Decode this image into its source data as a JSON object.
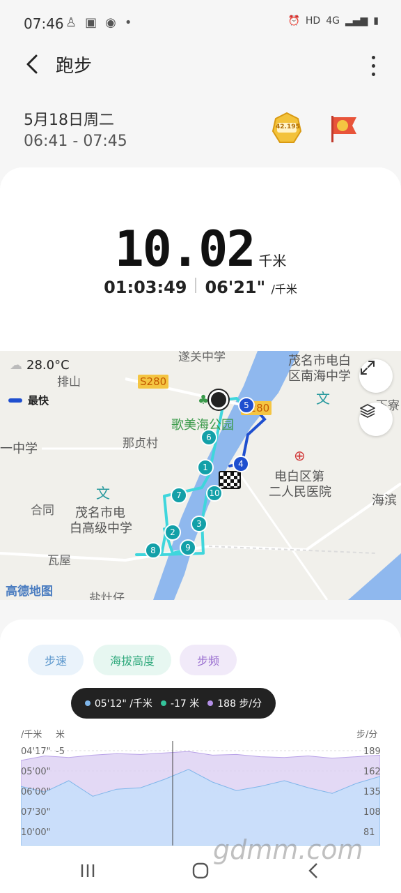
{
  "status_bar": {
    "time": "07:46",
    "network": "HD",
    "signal": "4G"
  },
  "header": {
    "title": "跑步"
  },
  "session": {
    "date": "5月18日周二",
    "time_range": "06:41 - 07:45",
    "badge_text": "42.195"
  },
  "summary": {
    "distance": "10.02",
    "distance_unit": "千米",
    "duration": "01:03:49",
    "pace": "06'21\"",
    "pace_unit": "/千米"
  },
  "map": {
    "temperature": "28.0°C",
    "legend_label": "最快",
    "labels": {
      "school_top": "遂关中学",
      "north_school_1": "茂名市电白",
      "north_school_2": "区南海中学",
      "paishan": "排山",
      "park": "歌美海公园",
      "village": "那贞村",
      "middle_school": "一中学",
      "hospital_1": "电白区第",
      "hospital_2": "二人民医院",
      "hehe": "合同",
      "school_1": "茂名市电",
      "school_2": "白高级中学",
      "wawu": "瓦屋",
      "haibin": "海滨",
      "bottom": "盐灶仔",
      "corner": "下寮",
      "road": "S280",
      "road2": "S280",
      "wen1": "文",
      "wen2": "文",
      "provider": "高德地图"
    },
    "markers": [
      "1",
      "2",
      "3",
      "4",
      "5",
      "6",
      "7",
      "8",
      "9",
      "10"
    ]
  },
  "chart_tabs": {
    "pace": "步速",
    "altitude": "海拔高度",
    "cadence": "步频"
  },
  "tooltip": {
    "pace": "05'12\" /千米",
    "altitude": "-17 米",
    "cadence": "188 步/分"
  },
  "chart_axes": {
    "left_unit_pace": "/千米",
    "left_unit_alt": "米",
    "right_unit": "步/分",
    "pace_ticks": [
      "04'17\"",
      "05'00\"",
      "06'00\"",
      "07'30\"",
      "10'00\""
    ],
    "alt_tick": "-5",
    "cadence_ticks": [
      "189",
      "162",
      "135",
      "108",
      "81"
    ]
  },
  "chart_data": {
    "type": "area",
    "series": [
      {
        "name": "步速",
        "values": [
          6.8,
          7.2,
          6.4,
          7.5,
          7.0,
          6.9,
          6.3,
          5.6,
          6.5,
          7.1,
          6.8,
          6.4,
          6.9,
          7.3,
          6.6,
          6.1
        ]
      },
      {
        "name": "步频",
        "values": [
          176,
          182,
          180,
          183,
          185,
          184,
          186,
          188,
          183,
          184,
          181,
          180,
          182,
          179,
          181,
          183
        ]
      }
    ],
    "colors": {
      "pace": "#7fb6ea",
      "altitude": "#34c39a",
      "cadence": "#b38fe6"
    }
  },
  "watermark": "gdmm.com"
}
